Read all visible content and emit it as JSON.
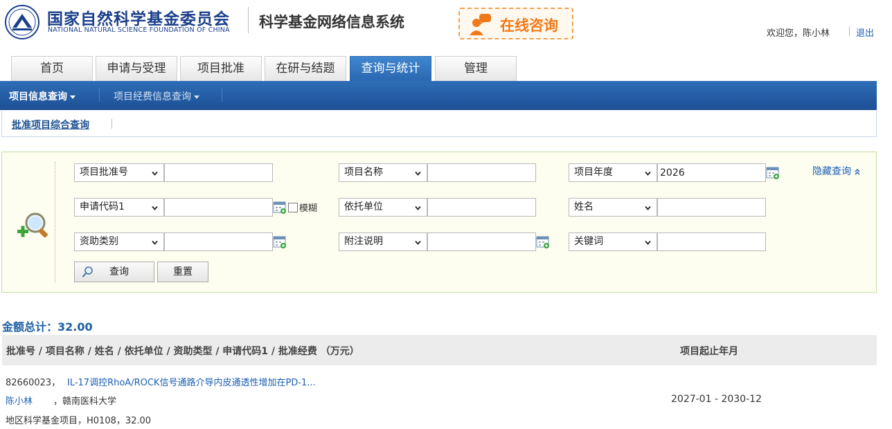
{
  "header": {
    "org_name_cn": "国家自然科学基金委员会",
    "org_name_en": "NATIONAL NATURAL SCIENCE FOUNDATION OF CHINA",
    "system_title": "科学基金网络信息系统",
    "consult_label": "在线咨询",
    "welcome_text": "欢迎您，陈小林",
    "logout_label": "退出"
  },
  "tabs": [
    {
      "label": "首页"
    },
    {
      "label": "申请与受理"
    },
    {
      "label": "项目批准"
    },
    {
      "label": "在研与结题"
    },
    {
      "label": "查询与统计",
      "active": true
    },
    {
      "label": "管理"
    }
  ],
  "subnav": {
    "items": [
      {
        "label": "项目信息查询",
        "active": true
      },
      {
        "label": "项目经费信息查询",
        "active": false
      }
    ],
    "breadcrumb": "批准项目综合查询"
  },
  "search": {
    "fields": [
      {
        "select": "项目批准号",
        "value": ""
      },
      {
        "select": "项目名称",
        "value": ""
      },
      {
        "select": "项目年度",
        "value": "2026"
      },
      {
        "select": "申请代码1",
        "value": ""
      },
      {
        "select": "依托单位",
        "value": ""
      },
      {
        "select": "姓名",
        "value": ""
      },
      {
        "select": "资助类别",
        "value": ""
      },
      {
        "select": "附注说明",
        "value": ""
      },
      {
        "select": "关键词",
        "value": ""
      }
    ],
    "fuzzy_label": "模糊",
    "hide_label": "隐藏查询",
    "query_button": "查询",
    "reset_button": "重置"
  },
  "results": {
    "total_label": "金额总计：32.00",
    "header_left": "批准号 / 项目名称 / 姓名 / 依托单位 / 资助类型 / 申请代码1 / 批准经费 （万元）",
    "header_right": "项目起止年月",
    "rows": [
      {
        "approval_no": "82660023，",
        "title": "IL-17调控RhoA/ROCK信号通路介导内皮通透性增加在PD-1...",
        "person": "陈小林",
        "org": "，赣南医科大学",
        "info": "地区科学基金项目，H0108，32.00",
        "period": "2027-01 - 2030-12"
      }
    ]
  },
  "colors": {
    "brand_blue": "#1a3f8a",
    "tab_active": "#2a67b0",
    "subnav_bg": "#1d5097",
    "link_blue": "#1a5fb4",
    "consult_orange": "#f07a1a",
    "panel_bg": "#fdfdf0"
  },
  "icons": [
    "nsfc-emblem-icon",
    "chat-person-icon",
    "magnifier-icon",
    "calendar-icon",
    "chevron-down-icon",
    "double-chevron-up-icon",
    "search-icon"
  ]
}
